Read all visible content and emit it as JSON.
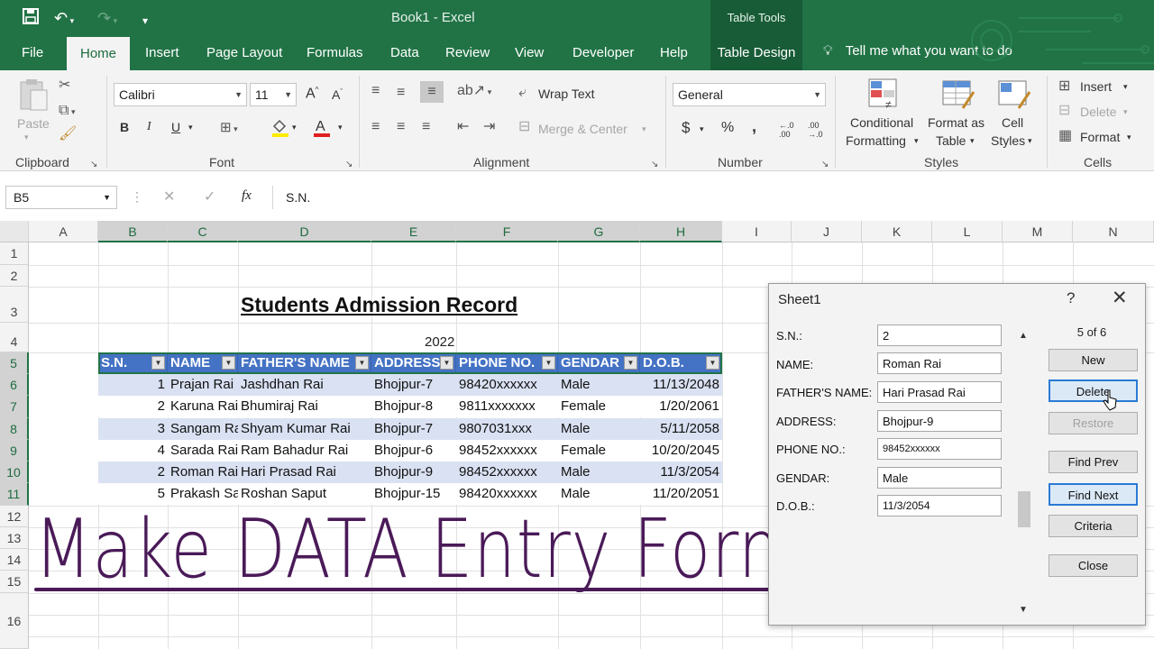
{
  "window": {
    "doc_title": "Book1 - Excel",
    "context_title": "Table Tools"
  },
  "tabs": [
    "File",
    "Home",
    "Insert",
    "Page Layout",
    "Formulas",
    "Data",
    "Review",
    "View",
    "Developer",
    "Help",
    "Table Design"
  ],
  "tell_me": "Tell me what you want to do",
  "ribbon": {
    "clipboard": {
      "paste": "Paste",
      "label": "Clipboard"
    },
    "font": {
      "name": "Calibri",
      "size": "11",
      "bold": "B",
      "italic": "I",
      "underline": "U",
      "label": "Font"
    },
    "alignment": {
      "wrap": "Wrap Text",
      "merge": "Merge & Center",
      "label": "Alignment"
    },
    "number": {
      "format": "General",
      "currency": "$",
      "percent": "%",
      "comma": ",",
      "inc": "←.0 .00",
      "dec": ".00 →.0",
      "label": "Number"
    },
    "styles": {
      "cond1": "Conditional",
      "cond2": "Formatting",
      "fmt1": "Format as",
      "fmt2": "Table",
      "cell1": "Cell",
      "cell2": "Styles",
      "label": "Styles"
    },
    "cells": {
      "insert": "Insert",
      "delete": "Delete",
      "format": "Format",
      "label": "Cells"
    }
  },
  "formula_bar": {
    "name_box": "B5",
    "fx": "fx",
    "content": "S.N."
  },
  "grid": {
    "columns": [
      "A",
      "B",
      "C",
      "D",
      "E",
      "F",
      "G",
      "H",
      "I",
      "J",
      "K",
      "L",
      "M",
      "N"
    ],
    "rows": [
      "1",
      "2",
      "3",
      "4",
      "5",
      "6",
      "7",
      "8",
      "9",
      "10",
      "11",
      "12",
      "13",
      "14",
      "15",
      "16"
    ]
  },
  "sheet": {
    "title": "Students Admission Record",
    "year": "2022",
    "headers": [
      "S.N.",
      "NAME",
      "FATHER'S NAME",
      "ADDRESS",
      "PHONE NO.",
      "GENDAR",
      "D.O.B."
    ],
    "rows": [
      [
        "1",
        "Prajan Rai",
        "Jashdhan Rai",
        "Bhojpur-7",
        "98420xxxxxx",
        "Male",
        "11/13/2048"
      ],
      [
        "2",
        "Karuna Rai",
        "Bhumiraj Rai",
        "Bhojpur-8",
        "9811xxxxxxx",
        "Female",
        "1/20/2061"
      ],
      [
        "3",
        "Sangam Rai",
        "Shyam Kumar Rai",
        "Bhojpur-7",
        "9807031xxx",
        "Male",
        "5/11/2058"
      ],
      [
        "4",
        "Sarada Rai",
        "Ram Bahadur Rai",
        "Bhojpur-6",
        "98452xxxxxx",
        "Female",
        "10/20/2045"
      ],
      [
        "2",
        "Roman Rai",
        "Hari Prasad Rai",
        "Bhojpur-9",
        "98452xxxxxx",
        "Male",
        "11/3/2054"
      ],
      [
        "5",
        "Prakash Saput",
        "Roshan Saput",
        "Bhojpur-15",
        "98420xxxxxx",
        "Male",
        "11/20/2051"
      ]
    ]
  },
  "overlay_text": "Make DATA Entry Form",
  "dialog": {
    "title": "Sheet1",
    "help": "?",
    "close": "✕",
    "record": "5 of 6",
    "fields": [
      {
        "label": "S.N.:",
        "value": "2"
      },
      {
        "label": "NAME:",
        "value": "Roman Rai"
      },
      {
        "label": "FATHER'S NAME:",
        "value": "Hari Prasad Rai"
      },
      {
        "label": "ADDRESS:",
        "value": "Bhojpur-9"
      },
      {
        "label": "PHONE NO.:",
        "value": "98452xxxxxx"
      },
      {
        "label": "GENDAR:",
        "value": "Male"
      },
      {
        "label": "D.O.B.:",
        "value": "11/3/2054"
      }
    ],
    "buttons": {
      "new": "New",
      "delete": "Delete",
      "restore": "Restore",
      "find_prev": "Find Prev",
      "find_next": "Find Next",
      "criteria": "Criteria",
      "close": "Close"
    }
  },
  "colors": {
    "excel_green": "#217346",
    "table_header": "#4472c4",
    "band": "#d9e1f2",
    "ink": "#4a1a58"
  }
}
